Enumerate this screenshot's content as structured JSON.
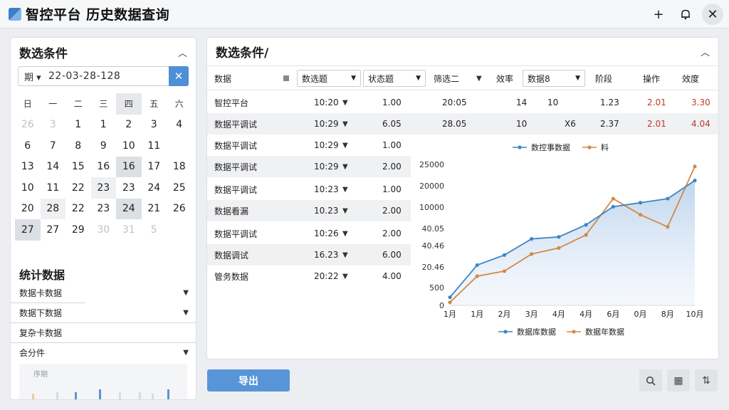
{
  "titlebar": {
    "title": "智控平台 历史数据查询",
    "add": "+",
    "bell": "🔔",
    "close": "✕"
  },
  "left": {
    "title": "数选条件",
    "date_label": "期 ▾",
    "date_value": "22-03-28-128",
    "date_clear": "✕",
    "calendar_head": [
      "日",
      "一",
      "二",
      "三",
      "四",
      "五",
      "六"
    ],
    "calendar_days": [
      [
        "26",
        "3",
        "1",
        "1",
        "2",
        "3",
        "4"
      ],
      [
        "6",
        "7",
        "8",
        "9",
        "10",
        "11"
      ],
      [
        "13",
        "14",
        "15",
        "16",
        "16",
        "17",
        "18"
      ],
      [
        "10",
        "11",
        "22",
        "23",
        "23",
        "24",
        "25"
      ],
      [
        "20",
        "28",
        "22",
        "23",
        "24",
        "21",
        "26"
      ],
      [
        "27",
        "27",
        "29",
        "30",
        "31",
        "5"
      ]
    ],
    "section2_title": "统计数据",
    "dropdowns": [
      "数据卡数据",
      "数据下数据",
      "复杂卡数据",
      "会分件"
    ],
    "mini_label": "序期"
  },
  "right": {
    "title": "数选条件/",
    "filter": {
      "label1": "数据",
      "sel1": "数选题",
      "sel2": "状态题",
      "label2": "筛选二",
      "label3": "效率",
      "sel3": "数据8",
      "col_a": "阶段",
      "col_b": "操作",
      "col_c": "效度"
    },
    "rows": [
      {
        "name": "智控平台",
        "time": "10:20",
        "val": "1.00",
        "t2": "20:05",
        "n1": "14",
        "n2": "10",
        "n3": "",
        "v1": "1.23",
        "v2": "2.01",
        "v3": "3.30"
      },
      {
        "name": "数据平调试",
        "time": "10:29",
        "val": "6.05",
        "t2": "28.05",
        "n1": "10",
        "n2": "",
        "n3": "X6",
        "v1": "2.37",
        "v2": "2.01",
        "v3": "4.04"
      },
      {
        "name": "数据平调试",
        "time": "10:29",
        "val": "1.00"
      },
      {
        "name": "数据平调试",
        "time": "10:29",
        "val": "2.00"
      },
      {
        "name": "数据平调试",
        "time": "10:23",
        "val": "1.00"
      },
      {
        "name": "数据看漏",
        "time": "10.23",
        "val": "2.00"
      },
      {
        "name": "数据平调试",
        "time": "10:26",
        "val": "2.00"
      },
      {
        "name": "数据调试",
        "time": "16.23",
        "val": "6.00"
      },
      {
        "name": "管务数据",
        "time": "20:22",
        "val": "4.00"
      }
    ]
  },
  "chart_data": {
    "type": "line",
    "legend_top": [
      "数控事数据",
      "料"
    ],
    "legend_bottom": [
      "数据库数据",
      "数据年数据"
    ],
    "y_ticks": [
      "0",
      "500",
      "20.46",
      "40.46",
      "40.05",
      "10000",
      "20000",
      "25000"
    ],
    "x_ticks": [
      "1月",
      "1月",
      "2月",
      "3月",
      "4月",
      "4月",
      "6月",
      "0月",
      "8月",
      "10月"
    ],
    "series": [
      {
        "color": "#3d85c6",
        "values": [
          0.4,
          2.0,
          2.5,
          3.3,
          3.4,
          4.0,
          4.9,
          5.1,
          5.3,
          6.2
        ]
      },
      {
        "color": "#d08a4a",
        "values": [
          0.15,
          1.45,
          1.7,
          2.55,
          2.85,
          3.5,
          5.3,
          4.5,
          3.9,
          6.9
        ]
      }
    ],
    "colors": {
      "blue": "#3d85c6",
      "orange": "#d08a4a"
    }
  },
  "bottom": {
    "export": "导出",
    "search_icon": "🔍",
    "grid_icon": "▦",
    "filter_icon": "⇅"
  }
}
